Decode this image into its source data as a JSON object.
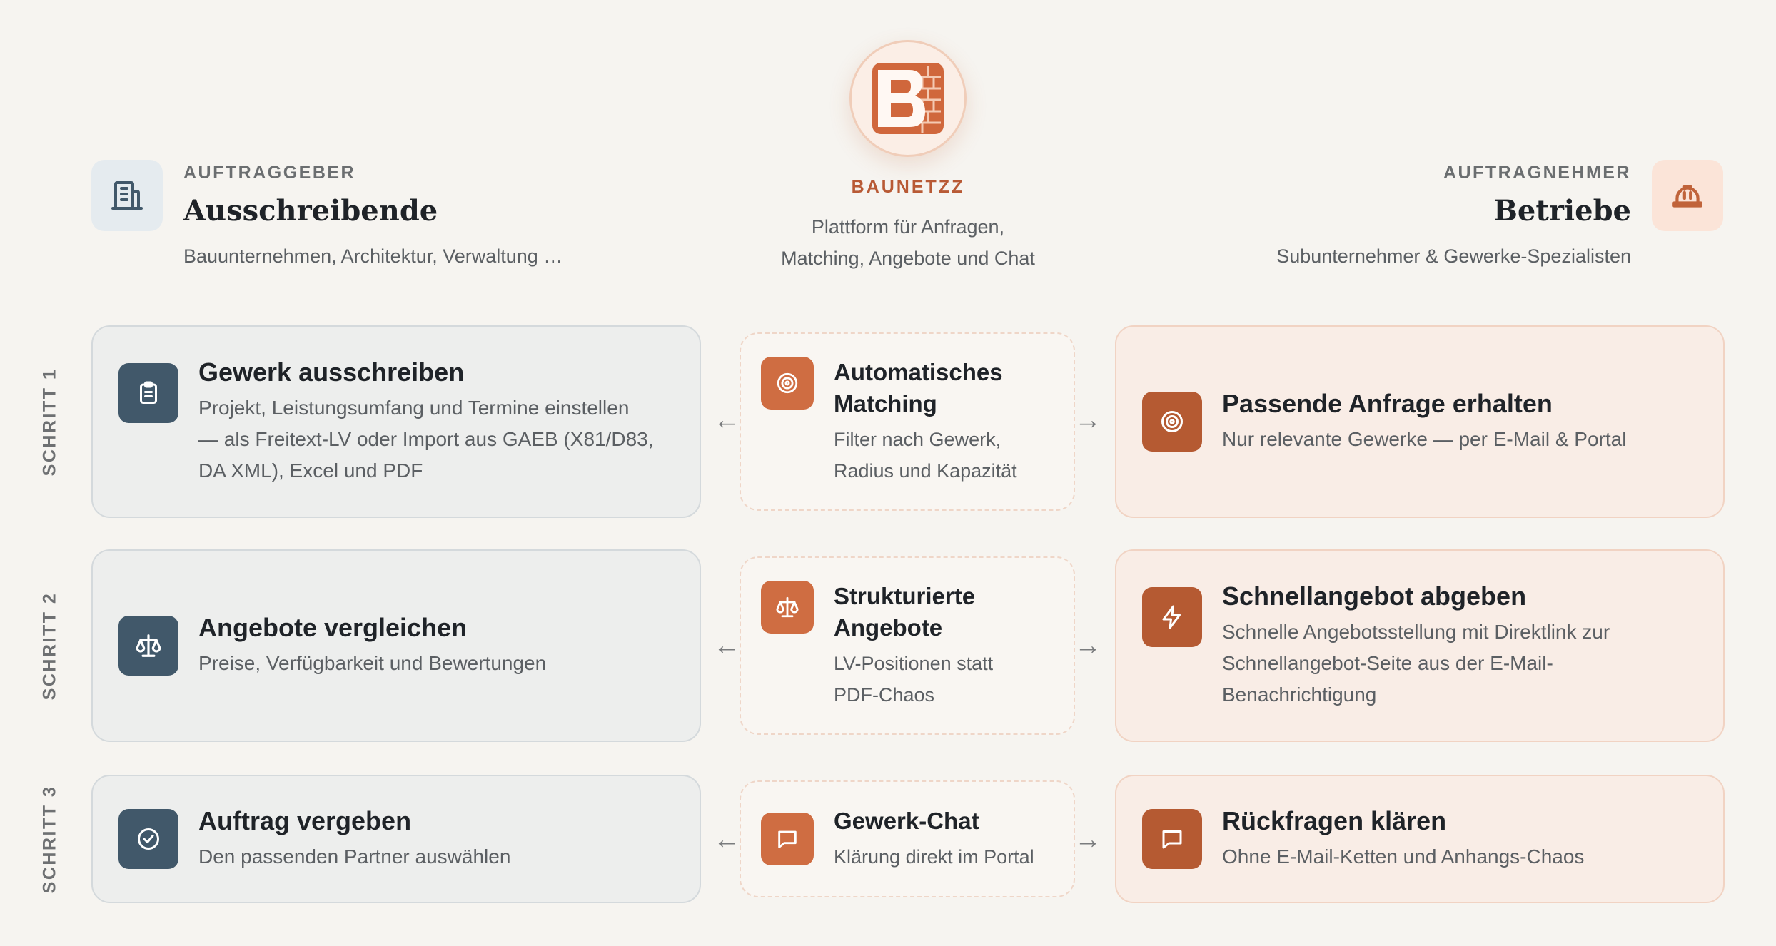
{
  "brand": {
    "name": "BAUNETZZ",
    "subtitle_line1": "Plattform für Anfragen,",
    "subtitle_line2": "Matching, Angebote und Chat"
  },
  "left_role": {
    "eyebrow": "AUFTRAGGEBER",
    "title": "Ausschreibende",
    "subtitle": "Bauunternehmen, Architektur, Verwaltung …",
    "icon": "building-icon"
  },
  "right_role": {
    "eyebrow": "AUFTRAGNEHMER",
    "title": "Betriebe",
    "subtitle": "Subunternehmer & Gewerke-Spezialisten",
    "icon": "hard-hat-icon"
  },
  "steps": [
    {
      "label": "SCHRITT 1",
      "left": {
        "title": "Gewerk ausschreiben",
        "desc1": "Projekt, Leistungsumfang und Termine einstellen",
        "desc2": "— als Freitext-LV oder Import aus GAEB (X81/D83,",
        "desc3": "DA XML), Excel und PDF",
        "icon": "clipboard-icon"
      },
      "mid": {
        "title1": "Automatisches",
        "title2": "Matching",
        "desc1": "Filter nach Gewerk,",
        "desc2": "Radius und Kapazität",
        "icon": "target-icon"
      },
      "right": {
        "title": "Passende Anfrage erhalten",
        "desc1": "Nur relevante Gewerke — per E-Mail & Portal",
        "icon": "target-icon"
      }
    },
    {
      "label": "SCHRITT 2",
      "left": {
        "title": "Angebote vergleichen",
        "desc1": "Preise, Verfügbarkeit und Bewertungen",
        "icon": "scale-icon"
      },
      "mid": {
        "title1": "Strukturierte",
        "title2": "Angebote",
        "desc1": "LV-Positionen statt",
        "desc2": "PDF-Chaos",
        "icon": "scale-icon"
      },
      "right": {
        "title": "Schnellangebot abgeben",
        "desc1": "Schnelle Angebotsstellung mit Direktlink zur",
        "desc2": "Schnellangebot-Seite aus der E-Mail-",
        "desc3": "Benachrichtigung",
        "icon": "lightning-icon"
      }
    },
    {
      "label": "SCHRITT 3",
      "left": {
        "title": "Auftrag vergeben",
        "desc1": "Den passenden Partner auswählen",
        "icon": "check-circle-icon"
      },
      "mid": {
        "title1": "Gewerk-Chat",
        "desc1": "Klärung direkt im Portal",
        "icon": "chat-icon"
      },
      "right": {
        "title": "Rückfragen klären",
        "desc1": "Ohne E-Mail-Ketten und Anhangs-Chaos",
        "icon": "chat-icon"
      }
    }
  ],
  "arrows": {
    "left": "←",
    "right": "→"
  },
  "colors": {
    "background": "#f6f4f0",
    "blue_icon": "#41586a",
    "rust_icon": "#b55a32",
    "orange_icon": "#cf6d42",
    "brand": "#b85a35"
  }
}
